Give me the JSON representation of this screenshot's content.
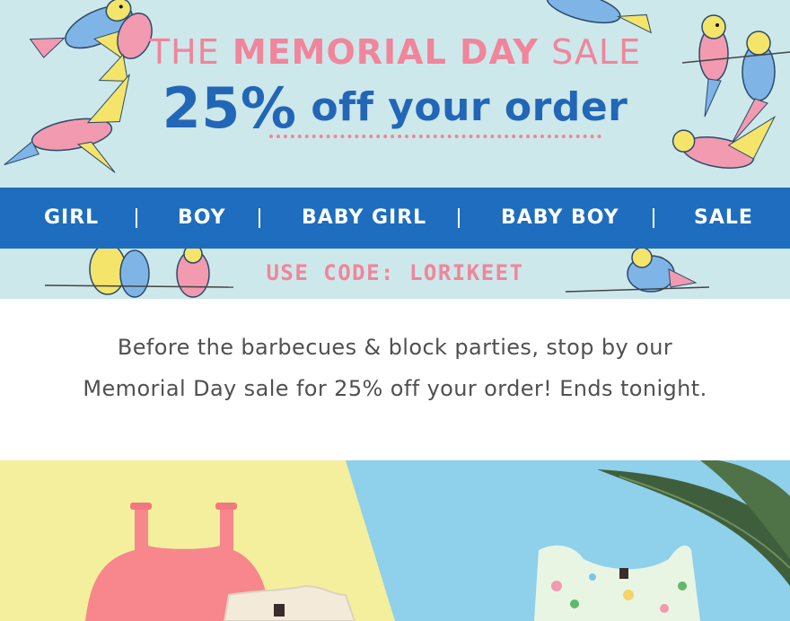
{
  "banner": {
    "line1_prefix": "THE",
    "line1_emphasis": "MEMORIAL DAY",
    "line1_suffix": "SALE",
    "discount": "25%",
    "discount_tail": "off your order",
    "promo_code_text": "USE CODE: LORIKEET",
    "decoration": "lorikeet-bird-illustrations"
  },
  "nav": {
    "items": [
      {
        "label": "GIRL"
      },
      {
        "label": "BOY"
      },
      {
        "label": "BABY GIRL"
      },
      {
        "label": "BABY BOY"
      },
      {
        "label": "SALE"
      }
    ]
  },
  "intro": {
    "line1": "Before the barbecues & block parties, stop by our",
    "line2": "Memorial Day sale for 25% off your order! Ends tonight."
  },
  "colors": {
    "hero_bg": "#cde8ea",
    "nav_bg": "#1f6dbf",
    "pink_accent": "#f0859b",
    "blue_text": "#2266b8",
    "body_text": "#505050",
    "photo_yellow": "#f4ef9c",
    "photo_blue": "#8fd0ea"
  },
  "product_photo": {
    "subject": "kids clothing flat-lay"
  }
}
